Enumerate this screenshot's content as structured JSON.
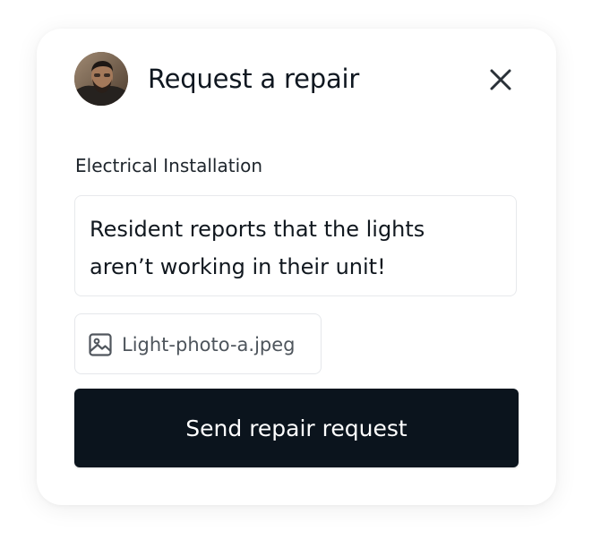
{
  "dialog": {
    "title": "Request a repair",
    "close_icon": "close-icon",
    "avatar_icon": "user-avatar"
  },
  "form": {
    "category_label": "Electrical Installation",
    "description_line1": "Resident reports that the lights",
    "description_line2": "aren’t working in their unit!",
    "attachment": {
      "icon": "image-icon",
      "filename": "Light-photo-a.jpeg"
    },
    "submit_label": "Send repair request"
  },
  "colors": {
    "primary_button": "#0b141d",
    "text": "#0f1720",
    "border": "#e7e9ec"
  }
}
